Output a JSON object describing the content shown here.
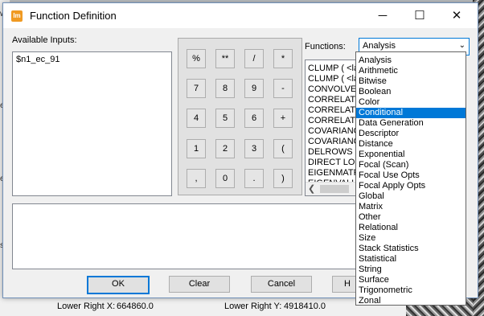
{
  "dialog": {
    "title": "Function Definition",
    "icon_label": "Im",
    "controls": {
      "minimize": "─",
      "maximize": "☐",
      "close": "✕"
    }
  },
  "inputs": {
    "label": "Available Inputs:",
    "items": [
      "$n1_ec_91"
    ]
  },
  "keypad": {
    "rows": [
      [
        "%",
        "**",
        "/",
        "*"
      ],
      [
        "7",
        "8",
        "9",
        "-"
      ],
      [
        "4",
        "5",
        "6",
        "+"
      ],
      [
        "1",
        "2",
        "3",
        "("
      ],
      [
        ",",
        "0",
        ".",
        ")"
      ]
    ]
  },
  "functions": {
    "label": "Functions:",
    "selected": "Analysis",
    "list": [
      "CLUMP ( <lay",
      "CLUMP ( <lay",
      "CONVOLVE (",
      "CORRELATIO",
      "CORRELATIO",
      "CORRELATIO",
      "COVARIANC",
      "COVARIANC",
      "DELROWS (",
      "DIRECT LOO",
      "EIGENMATR",
      "EIGENVALU"
    ],
    "dropdown_options": [
      "Analysis",
      "Arithmetic",
      "Bitwise",
      "Boolean",
      "Color",
      "Conditional",
      "Data Generation",
      "Descriptor",
      "Distance",
      "Exponential",
      "Focal (Scan)",
      "Focal Use Opts",
      "Focal Apply Opts",
      "Global",
      "Matrix",
      "Other",
      "Relational",
      "Size",
      "Stack Statistics",
      "Statistical",
      "String",
      "Surface",
      "Trigonometric",
      "Zonal"
    ],
    "highlighted": "Conditional"
  },
  "buttons": {
    "ok": "OK",
    "clear": "Clear",
    "cancel": "Cancel",
    "help": "H"
  },
  "background": {
    "lower_right_x_label": "Lower Right X:",
    "lower_right_x_value": "664860.0",
    "lower_right_y_label": "Lower Right Y:",
    "lower_right_y_value": "4918410.0",
    "left_fragments": [
      "w",
      "e",
      "er",
      "s"
    ]
  },
  "colors": {
    "accent": "#0078d7",
    "icon": "#f09a22"
  }
}
